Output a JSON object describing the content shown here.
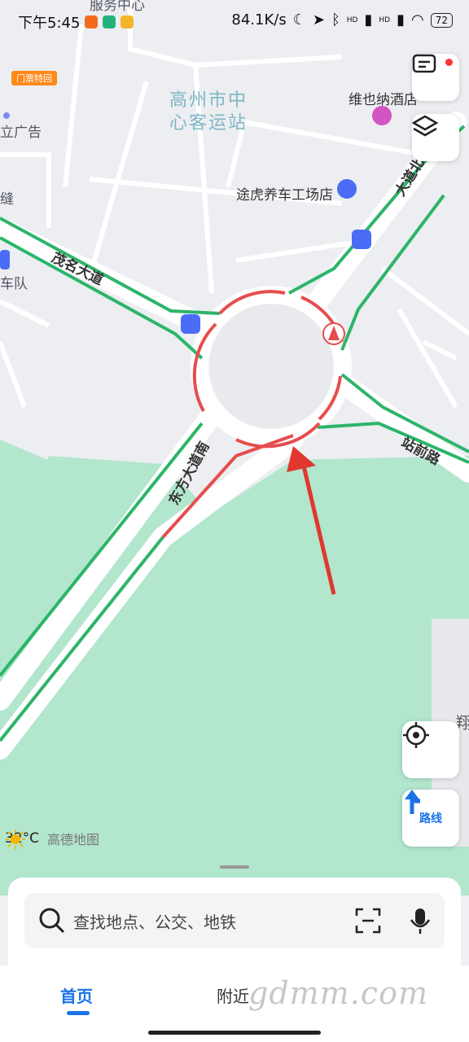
{
  "status": {
    "time": "下午5:45",
    "network_speed": "84.1K/s",
    "battery": "72",
    "signal_tags": [
      "HD",
      "HD"
    ]
  },
  "map": {
    "badge": "门票特回",
    "poi_top": "服务中心",
    "labels": {
      "ad": "立广告",
      "feng": "缝",
      "team": "车队",
      "station_line1": "高州市中",
      "station_line2": "心客运站",
      "hotel": "维也纳酒店",
      "garage": "途虎养车工场店",
      "xiang": "翔"
    },
    "roads": {
      "maoming": "茂名大道",
      "dongfang": "东方大道南",
      "zhanqian": "站前路",
      "north": "大道北"
    },
    "colors": {
      "road": "#ffffff",
      "traffic_green": "#2cb56a",
      "traffic_red": "#e64d4d",
      "park": "#b2e6cd",
      "arrow": "#e0382e"
    },
    "weather": {
      "temp": "32°C",
      "brand": "高德地图"
    }
  },
  "controls": {
    "messages_icon": "message-icon",
    "layers_icon": "layers-icon",
    "locate_icon": "locate-icon",
    "route_label": "路线"
  },
  "search": {
    "placeholder": "查找地点、公交、地铁"
  },
  "tabs": {
    "home": "首页",
    "nearby": "附近"
  },
  "watermark": "gdmm.com"
}
